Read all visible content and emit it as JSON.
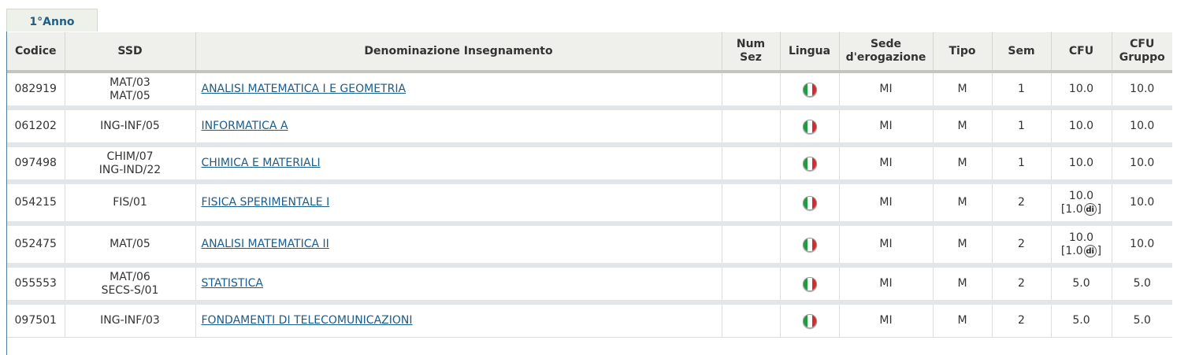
{
  "tab": {
    "label": "1°Anno"
  },
  "columns": {
    "codice": "Codice",
    "ssd": "SSD",
    "denominazione": "Denominazione Insegnamento",
    "num_sez_1": "Num",
    "num_sez_2": "Sez",
    "lingua": "Lingua",
    "sede_1": "Sede",
    "sede_2": "d'erogazione",
    "tipo": "Tipo",
    "sem": "Sem",
    "cfu": "CFU",
    "cfu_gruppo_1": "CFU",
    "cfu_gruppo_2": "Gruppo"
  },
  "rows": [
    {
      "codice": "082919",
      "ssd": [
        "MAT/03",
        "MAT/05"
      ],
      "nome": "ANALISI MATEMATICA I E GEOMETRIA",
      "num_sez": "",
      "lingua": "italian-flag-icon",
      "sede": "MI",
      "tipo": "M",
      "sem": "1",
      "cfu": "10.0",
      "cfu_extra": {
        "open": "",
        "value": "",
        "badge": "",
        "close": ""
      },
      "cfu_gruppo": "10.0"
    },
    {
      "codice": "061202",
      "ssd": [
        "ING-INF/05",
        ""
      ],
      "nome": "INFORMATICA A",
      "num_sez": "",
      "lingua": "italian-flag-icon",
      "sede": "MI",
      "tipo": "M",
      "sem": "1",
      "cfu": "10.0",
      "cfu_extra": {
        "open": "",
        "value": "",
        "badge": "",
        "close": ""
      },
      "cfu_gruppo": "10.0"
    },
    {
      "codice": "097498",
      "ssd": [
        "CHIM/07",
        "ING-IND/22"
      ],
      "nome": "CHIMICA E MATERIALI",
      "num_sez": "",
      "lingua": "italian-flag-icon",
      "sede": "MI",
      "tipo": "M",
      "sem": "1",
      "cfu": "10.0",
      "cfu_extra": {
        "open": "",
        "value": "",
        "badge": "",
        "close": ""
      },
      "cfu_gruppo": "10.0"
    },
    {
      "codice": "054215",
      "ssd": [
        "FIS/01",
        ""
      ],
      "nome": "FISICA SPERIMENTALE I",
      "num_sez": "",
      "lingua": "italian-flag-icon",
      "sede": "MI",
      "tipo": "M",
      "sem": "2",
      "cfu": "10.0",
      "cfu_extra": {
        "open": "[",
        "value": "1.0",
        "badge": "di",
        "close": "]"
      },
      "cfu_gruppo": "10.0"
    },
    {
      "codice": "052475",
      "ssd": [
        "MAT/05",
        ""
      ],
      "nome": "ANALISI MATEMATICA II",
      "num_sez": "",
      "lingua": "italian-flag-icon",
      "sede": "MI",
      "tipo": "M",
      "sem": "2",
      "cfu": "10.0",
      "cfu_extra": {
        "open": "[",
        "value": "1.0",
        "badge": "di",
        "close": "]"
      },
      "cfu_gruppo": "10.0"
    },
    {
      "codice": "055553",
      "ssd": [
        "MAT/06",
        "SECS-S/01"
      ],
      "nome": "STATISTICA",
      "num_sez": "",
      "lingua": "italian-flag-icon",
      "sede": "MI",
      "tipo": "M",
      "sem": "2",
      "cfu": "5.0",
      "cfu_extra": {
        "open": "",
        "value": "",
        "badge": "",
        "close": ""
      },
      "cfu_gruppo": "5.0"
    },
    {
      "codice": "097501",
      "ssd": [
        "ING-INF/03",
        ""
      ],
      "nome": "FONDAMENTI DI TELECOMUNICAZIONI",
      "num_sez": "",
      "lingua": "italian-flag-icon",
      "sede": "MI",
      "tipo": "M",
      "sem": "2",
      "cfu": "5.0",
      "cfu_extra": {
        "open": "",
        "value": "",
        "badge": "",
        "close": ""
      },
      "cfu_gruppo": "5.0"
    }
  ]
}
